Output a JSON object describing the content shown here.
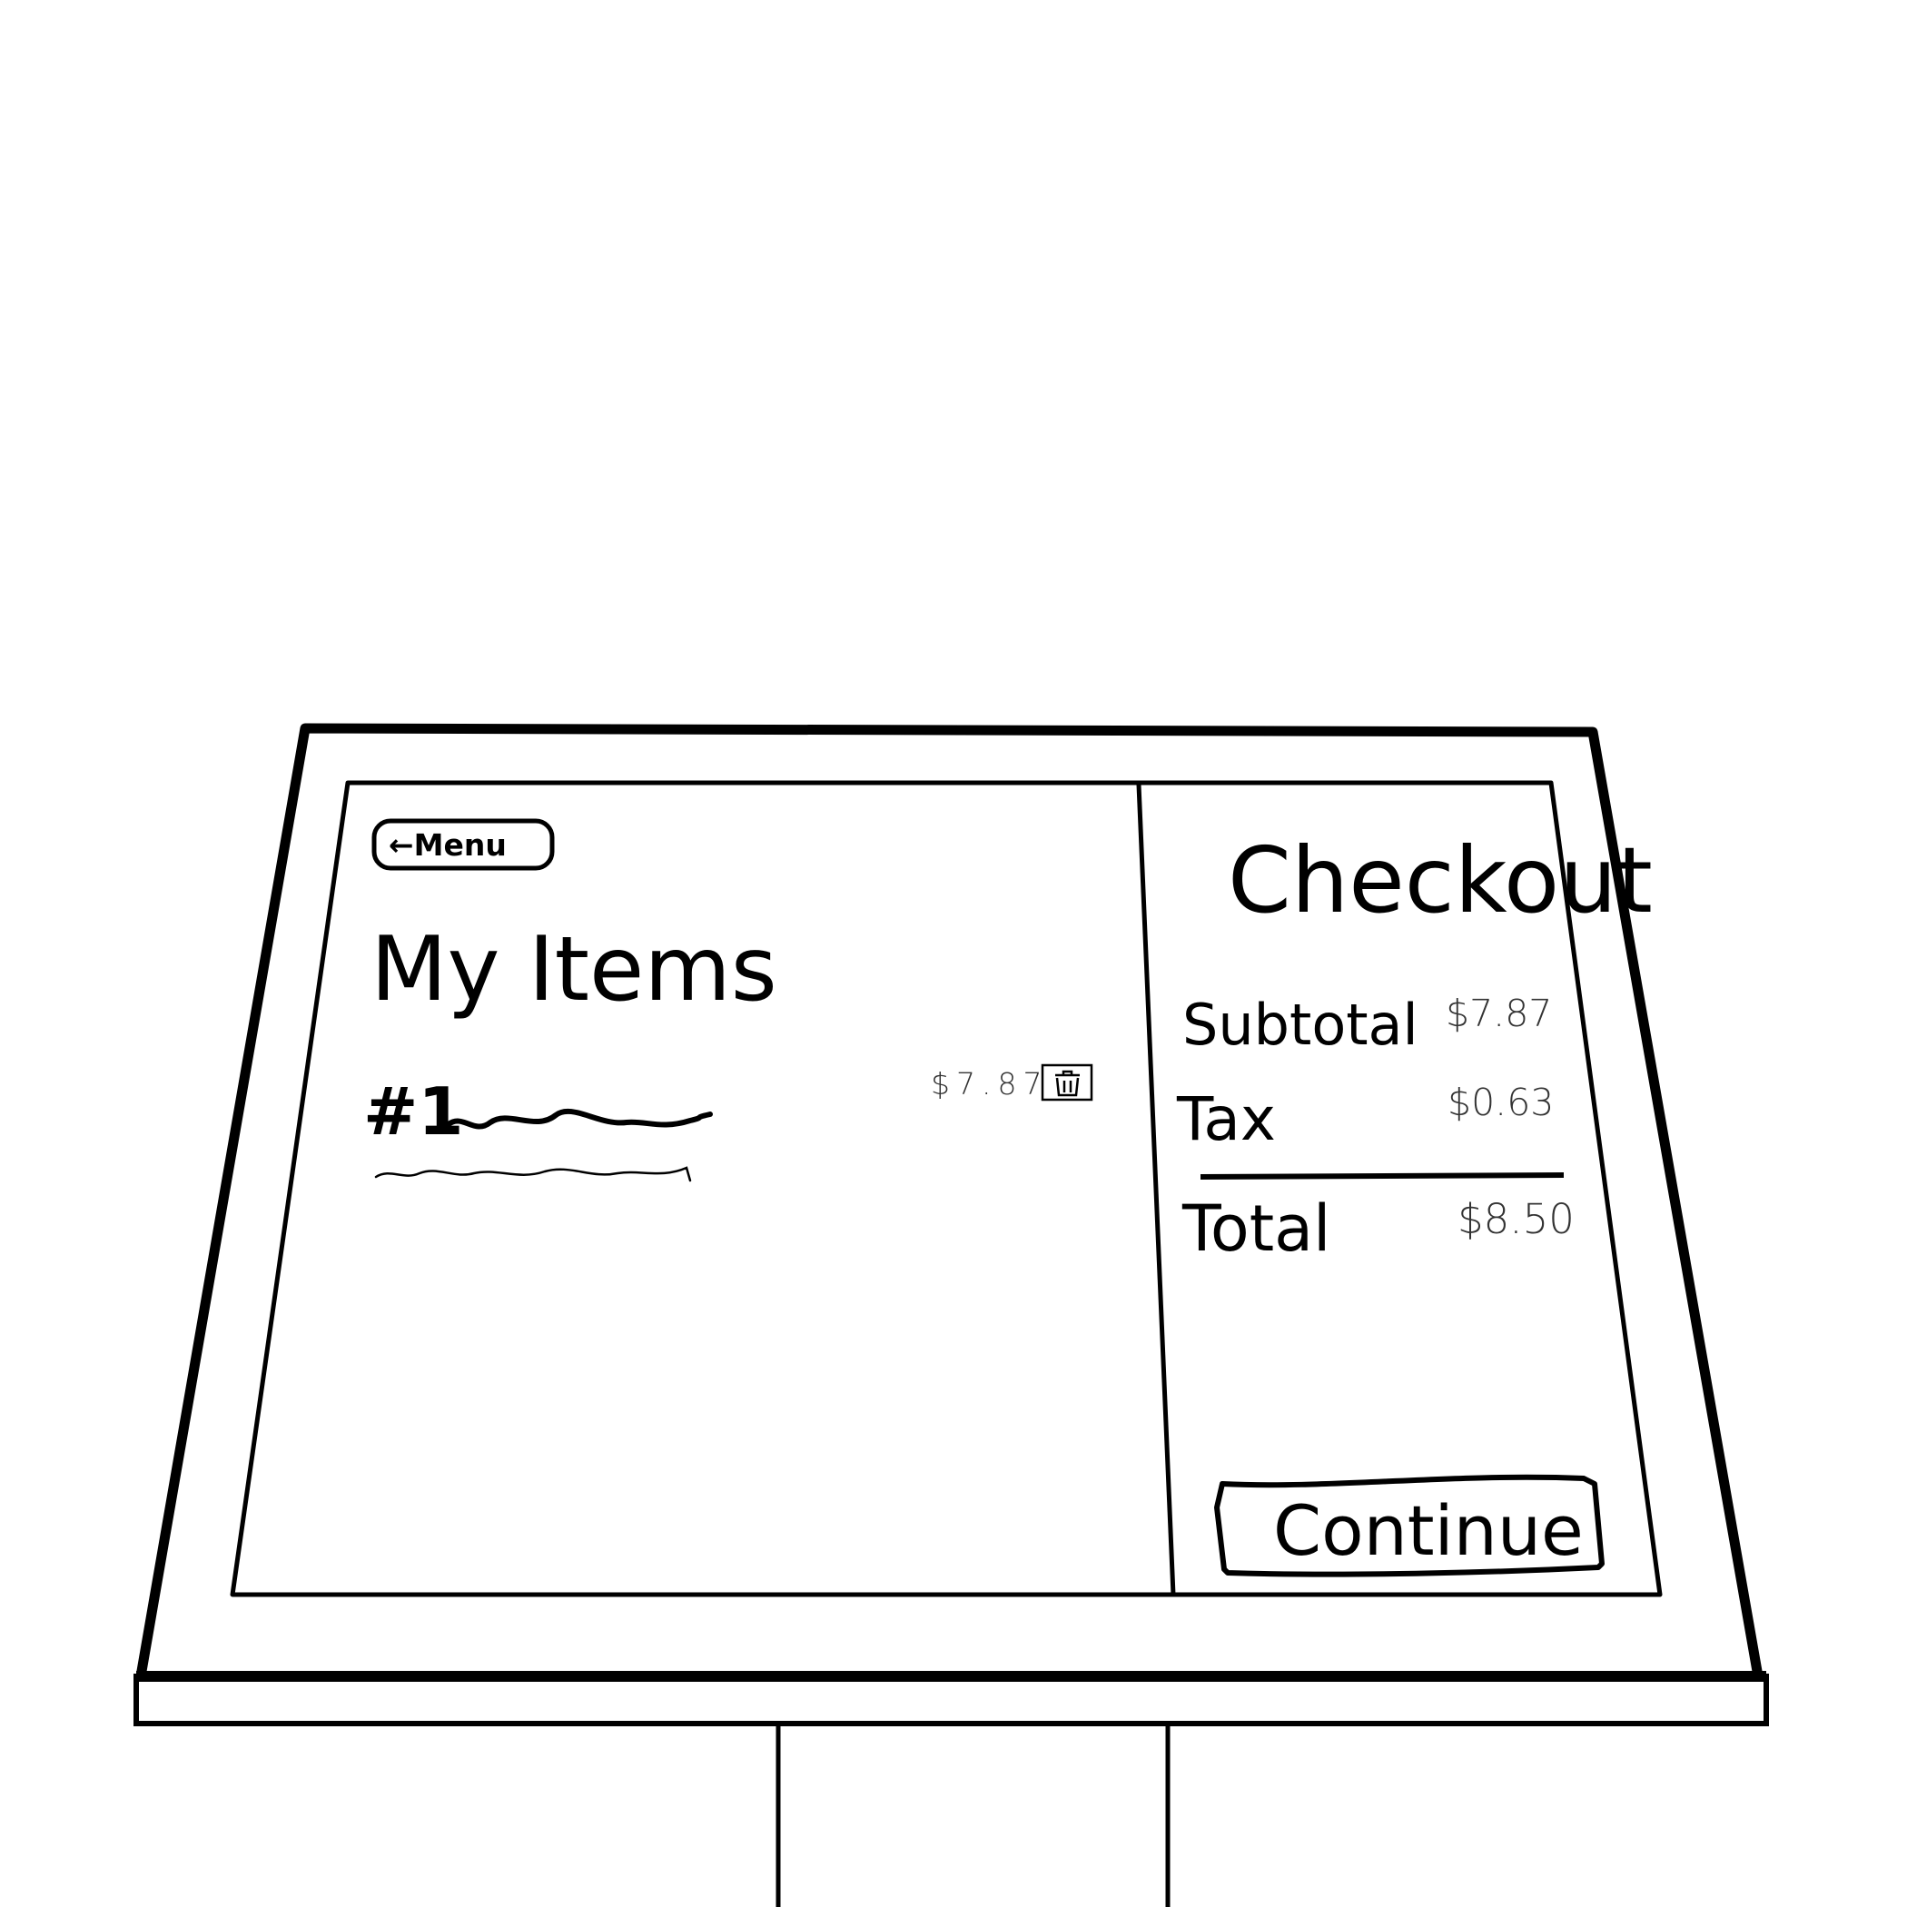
{
  "menu_button": {
    "label": "←Menu"
  },
  "items_panel": {
    "title": "My Items",
    "items": [
      {
        "number": "#1",
        "price": "$7.87",
        "delete_icon": "trash-icon"
      }
    ]
  },
  "checkout_panel": {
    "title": "Checkout",
    "subtotal_label": "Subtotal",
    "subtotal_value": "$7.87",
    "tax_label": "Tax",
    "tax_value": "$0.63",
    "total_label": "Total",
    "total_value": "$8.50",
    "continue_label": "Continue"
  }
}
